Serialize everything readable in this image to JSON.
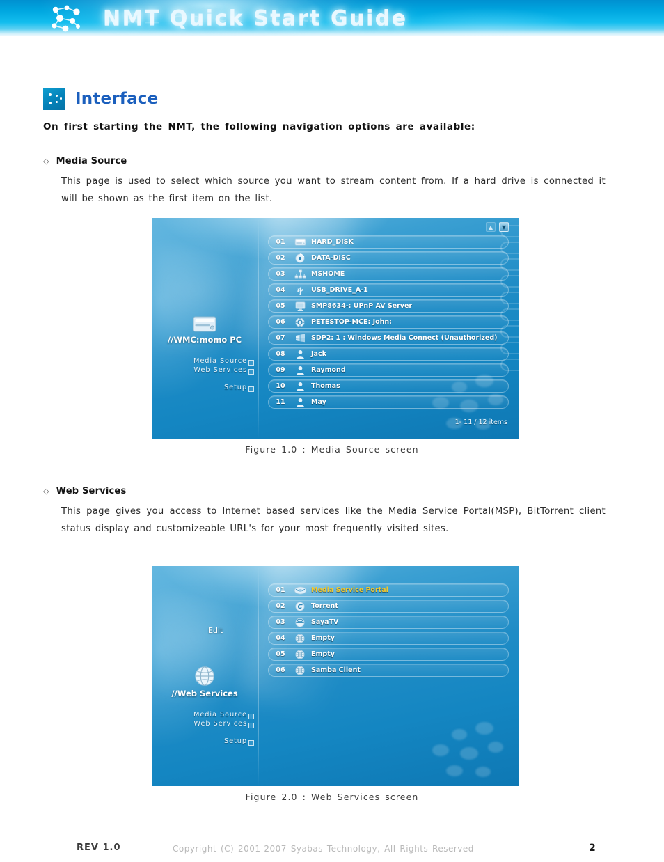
{
  "header": {
    "title": "NMT Quick Start Guide",
    "logo_icon": "network-nodes-logo"
  },
  "section": {
    "icon": "dots-square-icon",
    "title": "Interface",
    "intro": "On first starting the NMT, the following navigation options are available:"
  },
  "blocks": [
    {
      "bullet": "◇",
      "heading": "Media Source",
      "body": "This page is used to select which source you want to stream content from. If a hard drive is connected it will be shown as the first item on the list.",
      "caption": "Figure 1.0 : Media Source screen"
    },
    {
      "bullet": "◇",
      "heading": "Web Services",
      "body": "This page gives you access to Internet based services like the Media Service Portal(MSP), BitTorrent client status display and customizeable URL's for your most frequently visited sites.",
      "caption": "Figure 2.0 : Web Services screen"
    }
  ],
  "media_source_screen": {
    "device_label": "//WMC:momo PC",
    "device_icon": "hard-disk-icon",
    "nav": [
      {
        "label": "Media Source"
      },
      {
        "label": "Web Services"
      },
      {
        "label": "Setup"
      }
    ],
    "scroll_up": "▲",
    "scroll_down": "▼",
    "item_count": "1- 11 / 12 items",
    "items": [
      {
        "num": "01",
        "icon": "hard-disk-icon",
        "label": "HARD_DISK"
      },
      {
        "num": "02",
        "icon": "disc-icon",
        "label": "DATA-DISC"
      },
      {
        "num": "03",
        "icon": "network-icon",
        "label": "MSHOME"
      },
      {
        "num": "04",
        "icon": "usb-icon",
        "label": "USB_DRIVE_A-1"
      },
      {
        "num": "05",
        "icon": "monitor-icon",
        "label": "SMP8634-: UPnP AV Server"
      },
      {
        "num": "06",
        "icon": "gear-icon",
        "label": "PETESTOP-MCE: John:"
      },
      {
        "num": "07",
        "icon": "windows-icon",
        "label": "SDP2: 1 : Windows Media Connect (Unauthorized)"
      },
      {
        "num": "08",
        "icon": "user-icon",
        "label": "Jack"
      },
      {
        "num": "09",
        "icon": "user-icon",
        "label": "Raymond"
      },
      {
        "num": "10",
        "icon": "user-icon",
        "label": "Thomas"
      },
      {
        "num": "11",
        "icon": "user-icon",
        "label": "May"
      }
    ]
  },
  "web_services_screen": {
    "edit_label": "Edit",
    "device_label": "//Web Services",
    "device_icon": "globe-icon",
    "nav": [
      {
        "label": "Media Source"
      },
      {
        "label": "Web Services"
      },
      {
        "label": "Setup"
      }
    ],
    "highlight_color": "#f2c82e",
    "items": [
      {
        "num": "01",
        "icon": "msp-icon",
        "label": "Media Service Portal",
        "highlighted": true
      },
      {
        "num": "02",
        "icon": "torrent-icon",
        "label": "Torrent",
        "highlighted": false
      },
      {
        "num": "03",
        "icon": "sayatv-icon",
        "label": "SayaTV",
        "highlighted": false
      },
      {
        "num": "04",
        "icon": "globe-icon",
        "label": "Empty",
        "highlighted": false
      },
      {
        "num": "05",
        "icon": "globe-icon",
        "label": "Empty",
        "highlighted": false
      },
      {
        "num": "06",
        "icon": "globe-icon",
        "label": "Samba Client",
        "highlighted": false
      }
    ]
  },
  "footer": {
    "rev": "REV 1.0",
    "copyright": "Copyright (C) 2001-2007 Syabas Technology, All Rights Reserved",
    "page": "2"
  }
}
